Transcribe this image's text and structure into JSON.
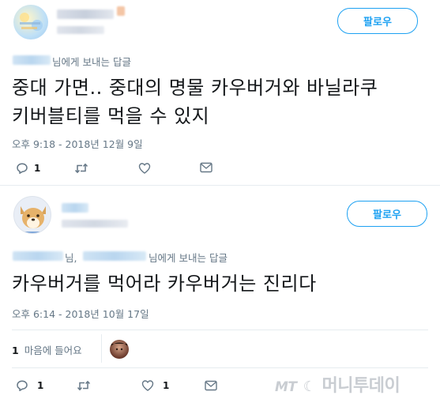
{
  "tweet1": {
    "follow_label": "팔로우",
    "replying_suffix": "님에게 보내는 답글",
    "text_line1": "중대 가면..  중대의 명물 카우버거와 바닐라쿠",
    "text_line2": "키버블티를 먹을 수 있지",
    "timestamp": "오후 9:18 - 2018년 12월 9일",
    "reply_count": "1"
  },
  "tweet2": {
    "follow_label": "팔로우",
    "replying_comma": "님,",
    "replying_suffix": "님에게 보내는 답글",
    "text_line1": "카우버거를 먹어라 카우버거는 진리다",
    "timestamp": "오후 6:14 - 2018년 10월 17일",
    "likes_count": "1",
    "likes_label": "마음에 들어요",
    "reply_count": "1",
    "like_count": "1"
  },
  "watermark": {
    "prefix": "MT",
    "text": "머니투데이"
  },
  "colors": {
    "accent": "#1da1f2",
    "muted": "#657786",
    "divider": "#e6ecf0"
  }
}
